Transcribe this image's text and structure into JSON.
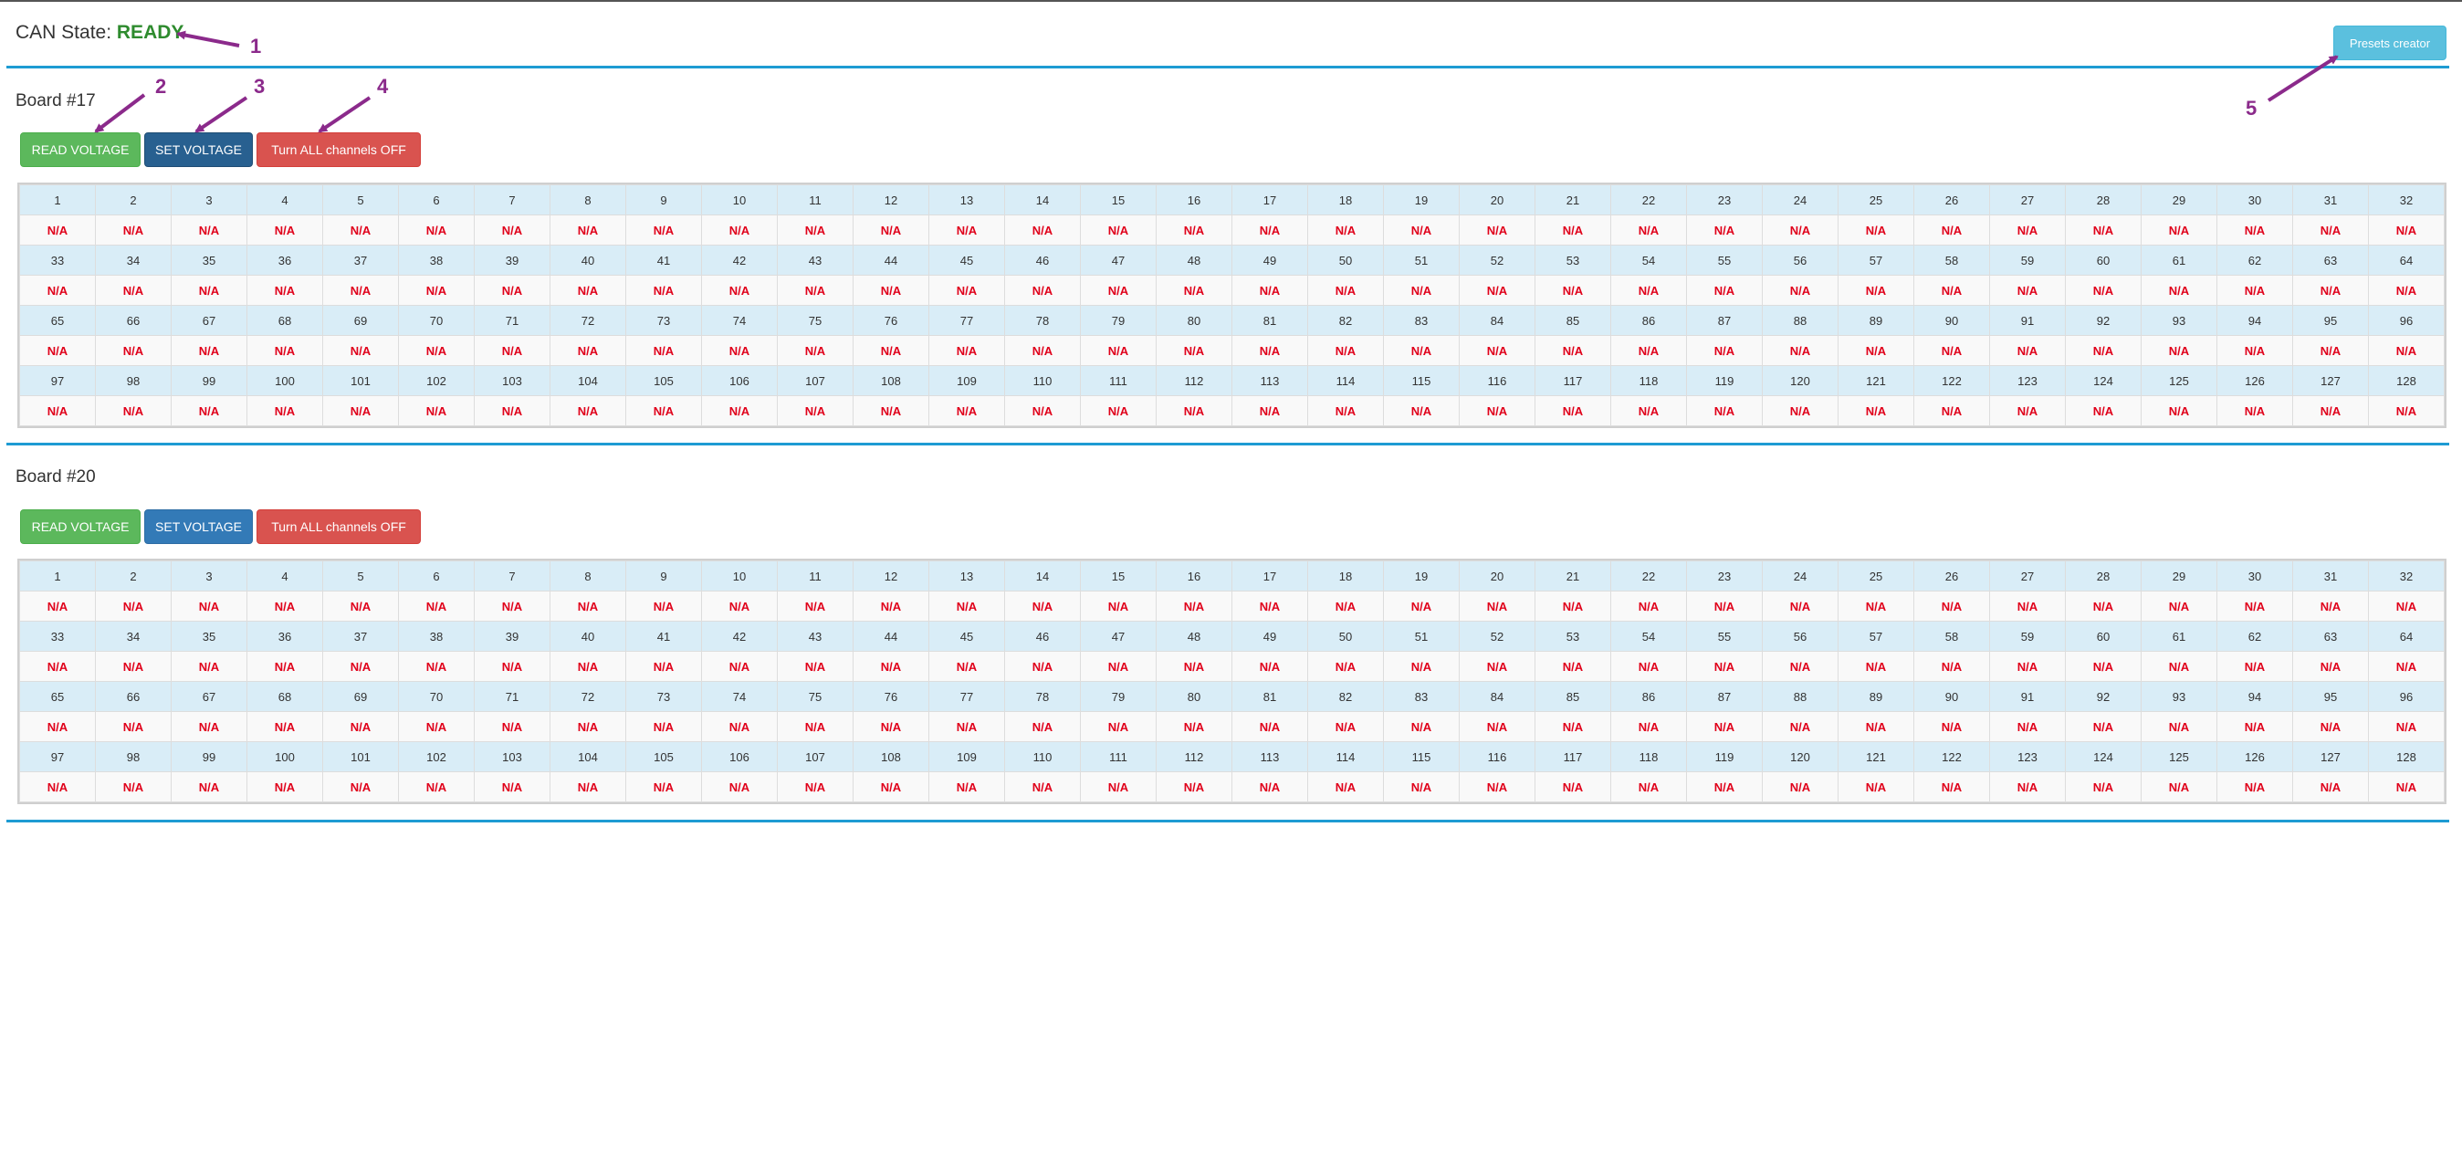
{
  "header": {
    "can_label": "CAN State:",
    "can_value": "READY",
    "presets_label": "Presets creator"
  },
  "annotations": [
    "1",
    "2",
    "3",
    "4",
    "5"
  ],
  "boards": [
    {
      "title": "Board #17",
      "read_label": "READ VOLTAGE",
      "set_label": "SET VOLTAGE",
      "off_label": "Turn ALL channels OFF",
      "channel_count": 128,
      "per_row": 32,
      "value_text": "N/A"
    },
    {
      "title": "Board #20",
      "read_label": "READ VOLTAGE",
      "set_label": "SET VOLTAGE",
      "off_label": "Turn ALL channels OFF",
      "channel_count": 128,
      "per_row": 32,
      "value_text": "N/A"
    }
  ],
  "colors": {
    "ready": "#2e8b2e",
    "divider": "#1e9bd3",
    "annotation": "#8b2a8b",
    "na_value": "#e0001a"
  }
}
